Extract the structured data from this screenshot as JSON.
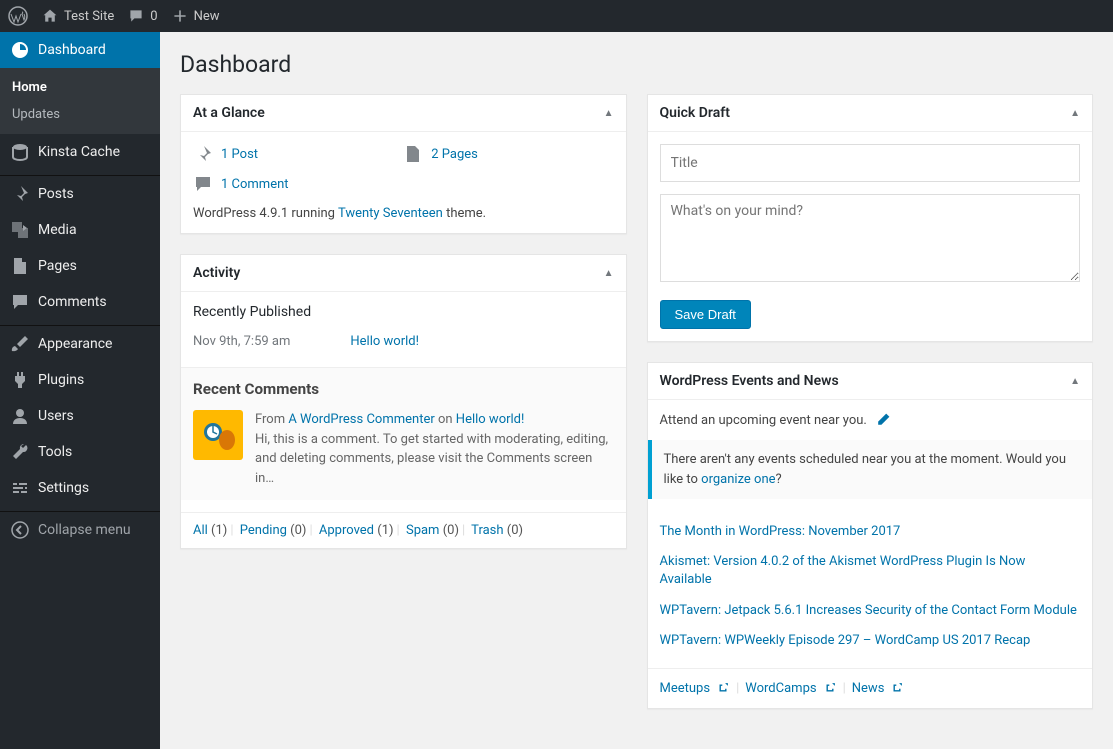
{
  "adminbar": {
    "site_name": "Test Site",
    "comments_count": "0",
    "new_label": "New"
  },
  "sidebar": {
    "dashboard": "Dashboard",
    "home": "Home",
    "updates": "Updates",
    "kinsta_cache": "Kinsta Cache",
    "posts": "Posts",
    "media": "Media",
    "pages": "Pages",
    "comments": "Comments",
    "appearance": "Appearance",
    "plugins": "Plugins",
    "users": "Users",
    "tools": "Tools",
    "settings": "Settings",
    "collapse": "Collapse menu"
  },
  "page_title": "Dashboard",
  "glance": {
    "title": "At a Glance",
    "post": "1 Post",
    "pages": "2 Pages",
    "comment": "1 Comment",
    "version_pre": "WordPress 4.9.1 running ",
    "theme": "Twenty Seventeen",
    "version_post": " theme."
  },
  "activity": {
    "title": "Activity",
    "recently_published": "Recently Published",
    "pub_date": "Nov 9th, 7:59 am",
    "pub_title": "Hello world!",
    "recent_comments": "Recent Comments",
    "from": "From ",
    "commenter": "A WordPress Commenter",
    "on": " on ",
    "on_post": "Hello world!",
    "comment_text": "Hi, this is a comment. To get started with moderating, editing, and deleting comments, please visit the Comments screen in…",
    "filters": {
      "all": "All",
      "all_count": "(1)",
      "pending": "Pending",
      "pending_count": "(0)",
      "approved": "Approved",
      "approved_count": "(1)",
      "spam": "Spam",
      "spam_count": "(0)",
      "trash": "Trash",
      "trash_count": "(0)"
    }
  },
  "quick_draft": {
    "title": "Quick Draft",
    "title_placeholder": "Title",
    "content_placeholder": "What's on your mind?",
    "save": "Save Draft"
  },
  "events": {
    "title": "WordPress Events and News",
    "intro": "Attend an upcoming event near you.",
    "no_events_pre": "There aren't any events scheduled near you at the moment. Would you like to ",
    "organize": "organize one",
    "no_events_post": "?",
    "news": [
      "The Month in WordPress: November 2017",
      "Akismet: Version 4.0.2 of the Akismet WordPress Plugin Is Now Available",
      "WPTavern: Jetpack 5.6.1 Increases Security of the Contact Form Module",
      "WPTavern: WPWeekly Episode 297 – WordCamp US 2017 Recap"
    ],
    "footer": {
      "meetups": "Meetups",
      "wordcamps": "WordCamps",
      "news": "News"
    }
  }
}
